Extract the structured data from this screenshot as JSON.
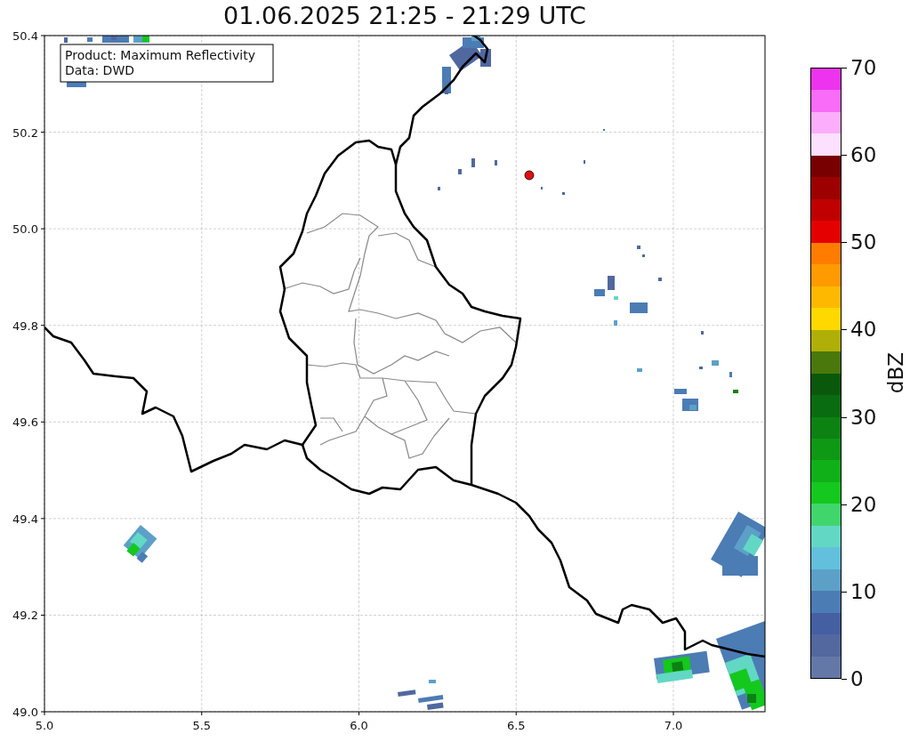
{
  "title": "01.06.2025 21:25 - 21:29 UTC",
  "info": [
    "Product: Maximum Reflectivity",
    "Data: DWD"
  ],
  "x_ticks": [
    "5.0",
    "5.5",
    "6.0",
    "6.5",
    "7.0"
  ],
  "y_ticks": [
    "50.4",
    "50.2",
    "50.0",
    "49.8",
    "49.6",
    "49.4",
    "49.2",
    "49.0"
  ],
  "colorbar": {
    "label": "dBZ",
    "ticks": [
      "70",
      "60",
      "50",
      "40",
      "30",
      "20",
      "10",
      "0"
    ],
    "bands": [
      {
        "color": "#ee33ee"
      },
      {
        "color": "#f86cf8"
      },
      {
        "color": "#fcaefc"
      },
      {
        "color": "#fde0fd"
      },
      {
        "color": "#780000"
      },
      {
        "color": "#9c0000"
      },
      {
        "color": "#c00000"
      },
      {
        "color": "#e40000"
      },
      {
        "color": "#ff7c00"
      },
      {
        "color": "#ff9a00"
      },
      {
        "color": "#ffb800"
      },
      {
        "color": "#ffd800"
      },
      {
        "color": "#afaf08"
      },
      {
        "color": "#4a780c"
      },
      {
        "color": "#0a580c"
      },
      {
        "color": "#0a6c10"
      },
      {
        "color": "#0c8212"
      },
      {
        "color": "#0e9814"
      },
      {
        "color": "#10b018"
      },
      {
        "color": "#14c81e"
      },
      {
        "color": "#40d66c"
      },
      {
        "color": "#62d8c4"
      },
      {
        "color": "#62c0dc"
      },
      {
        "color": "#5ca0c8"
      },
      {
        "color": "#4c7cb4"
      },
      {
        "color": "#4460a2"
      },
      {
        "color": "#52689e"
      },
      {
        "color": "#6478a8"
      }
    ]
  }
}
